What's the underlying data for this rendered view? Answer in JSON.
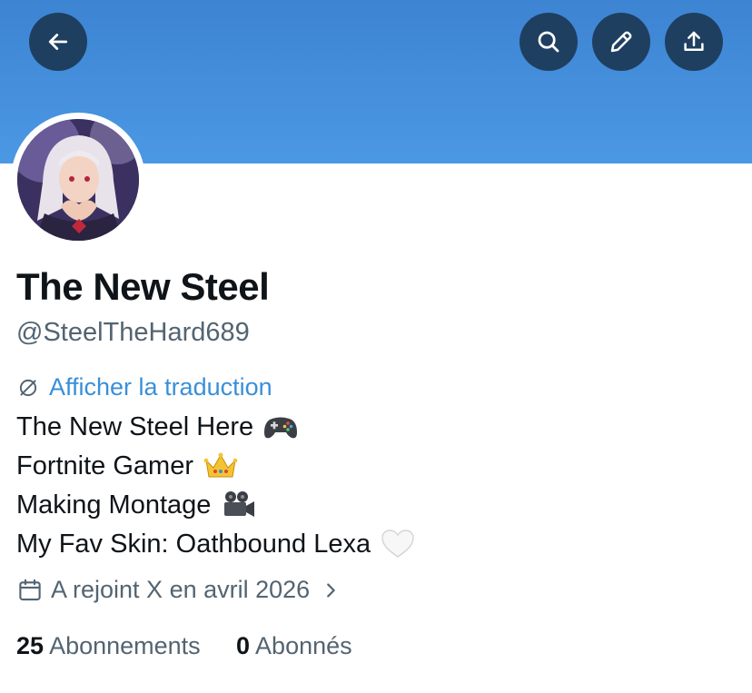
{
  "profile": {
    "display_name": "The New Steel",
    "handle": "@SteelTheHard689",
    "translate_label": "Afficher la traduction",
    "bio": [
      {
        "text": "The New Steel Here",
        "emoji": "gamepad-emoji"
      },
      {
        "text": "Fortnite Gamer",
        "emoji": "crown-emoji"
      },
      {
        "text": "Making Montage",
        "emoji": "movie-camera-emoji"
      },
      {
        "text": "My Fav Skin: Oathbound Lexa",
        "emoji": "white-heart-emoji"
      }
    ],
    "joined_label": "A rejoint X en avril 2026",
    "following_count": "25",
    "following_label": "Abonnements",
    "followers_count": "0",
    "followers_label": "Abonnés"
  },
  "header": {
    "buttons": [
      "back-arrow-icon",
      "search-icon",
      "edit-pencil-icon",
      "share-upload-icon"
    ]
  },
  "colors": {
    "banner": "#4b98e4",
    "header_button_bg": "#1f3f60",
    "link": "#3a8fd8",
    "secondary_text": "#536471",
    "primary_text": "#0f1419"
  }
}
